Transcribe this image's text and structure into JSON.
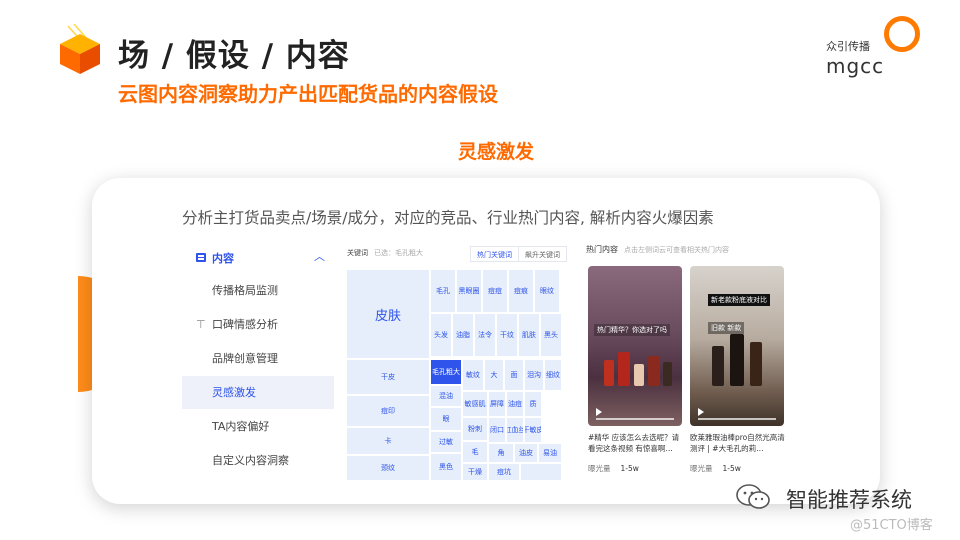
{
  "header": {
    "title": "场 / 假设 / 内容",
    "subtitle": "云图内容洞察助力产出匹配货品的内容假设"
  },
  "brand": {
    "cn": "众引传播",
    "en": "mgcc",
    "accent": "#ff7a00"
  },
  "section_title": "灵感激发",
  "card": {
    "headline": "分析主打货品卖点/场景/成分，对应的竞品、行业热门内容, 解析内容火爆因素"
  },
  "menu": {
    "head": "内容",
    "items": [
      {
        "label": "传播格局监测"
      },
      {
        "label": "口碑情感分析"
      },
      {
        "label": "品牌创意管理"
      },
      {
        "label": "灵感激发"
      },
      {
        "label": "TA内容偏好"
      },
      {
        "label": "自定义内容洞察"
      }
    ]
  },
  "treemap": {
    "keyword_label": "关键词",
    "selected_label": "已选：毛孔粗大",
    "tabs": [
      "热门关键词",
      "飙升关键词"
    ],
    "cells": [
      "皮肤",
      "毛孔",
      "黑眼圈",
      "痘痘",
      "痘痕",
      "眼纹",
      "头发",
      "油脂",
      "法令",
      "干纹",
      "肌肤",
      "黑头",
      "干皮",
      "毛孔粗大",
      "敏纹",
      "大",
      "面",
      "泪沟",
      "细纹",
      "痘印",
      "混油",
      "敏感肌",
      "屏障",
      "油痘",
      "质",
      "卡",
      "眼",
      "粉刺",
      "闭口",
      "红血丝",
      "干敏皮",
      "过敏",
      "毛",
      "角",
      "油皮",
      "易油",
      "颈纹",
      "黑色",
      "干燥",
      "痘坑"
    ]
  },
  "hot": {
    "head": "热门内容",
    "hint": "点击左侧词云可查看相关热门内容",
    "videos": [
      {
        "overlay": "热门精华？你选对了吗",
        "title": "#精华 应该怎么去选呢？请看完这条视频 有惊喜啊…",
        "metric": "曝光量",
        "value": "1-5w"
      },
      {
        "overlay": "新老款粉底液对比",
        "overlay2": "旧款  新款",
        "title": "欧莱雅瑕油棒pro自然光高清测评 | #大毛孔的莉…",
        "metric": "曝光量",
        "value": "1-5w"
      }
    ]
  },
  "footer": {
    "name": "智能推荐系统",
    "watermark": "@51CTO博客"
  }
}
